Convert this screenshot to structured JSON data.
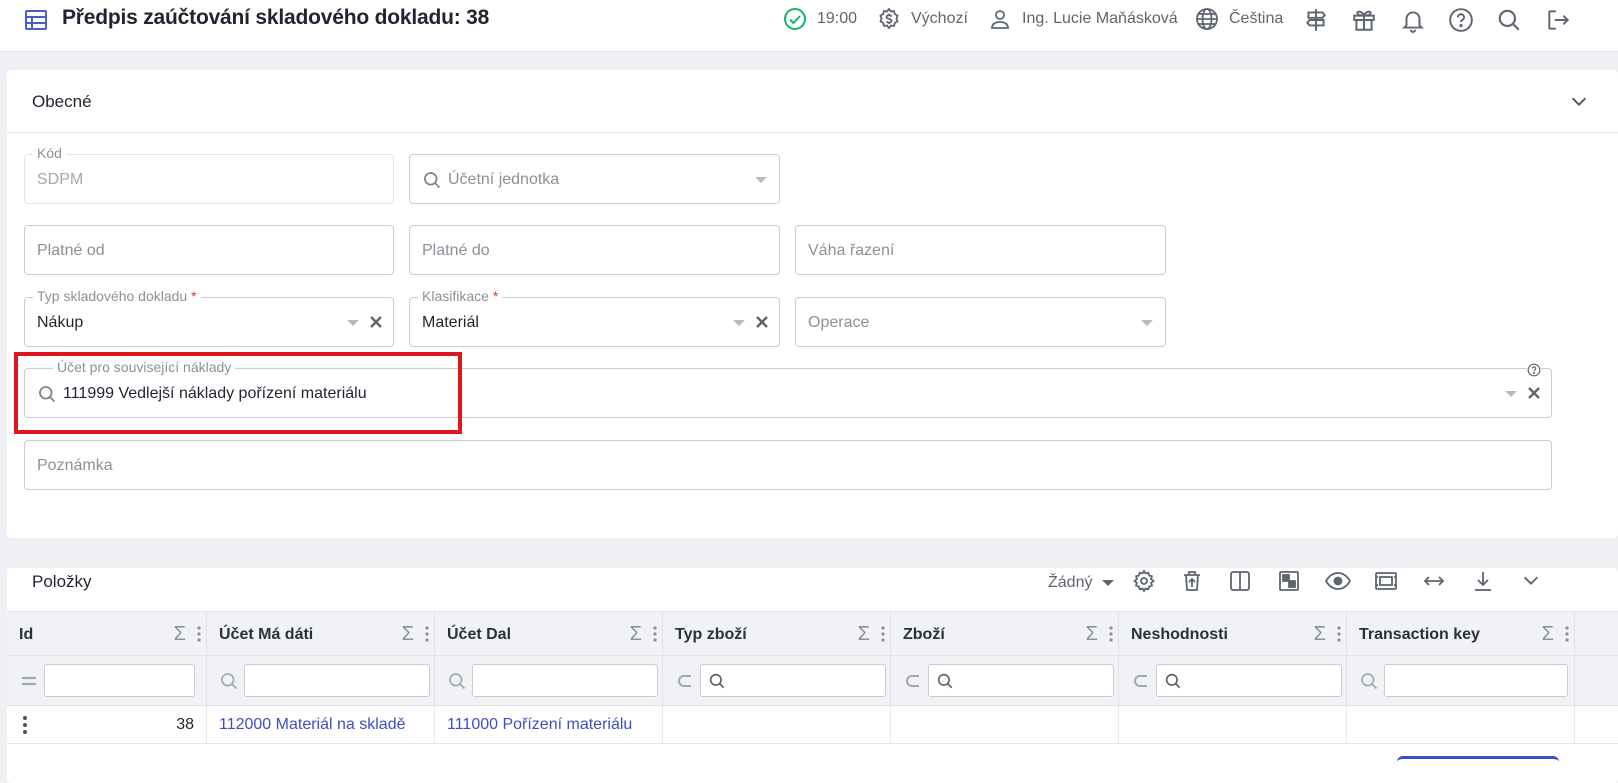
{
  "header": {
    "title": "Předpis zaúčtování skladového dokladu: 38",
    "time": "19:00",
    "currency_profile": "Výchozí",
    "user": "Ing. Lucie Maňásková",
    "language": "Čeština"
  },
  "general": {
    "title": "Obecné",
    "kod": {
      "label": "Kód",
      "value": "SDPM"
    },
    "ucetni_jednotka": {
      "placeholder": "Účetní jednotka"
    },
    "platne_od": {
      "placeholder": "Platné od"
    },
    "platne_do": {
      "placeholder": "Platné do"
    },
    "vaha_razeni": {
      "placeholder": "Váha řazení"
    },
    "typ_dokladu": {
      "label": "Typ skladového dokladu",
      "required": "*",
      "value": "Nákup"
    },
    "klasifikace": {
      "label": "Klasifikace",
      "required": "*",
      "value": "Materiál"
    },
    "operace": {
      "placeholder": "Operace"
    },
    "ucet_naklady": {
      "label": "Účet pro související náklady",
      "value": "111999 Vedlejší náklady pořízení materiálu"
    },
    "poznamka": {
      "placeholder": "Poznámka"
    }
  },
  "items": {
    "title": "Položky",
    "grouping": "Žádný",
    "columns": [
      {
        "label": "Id"
      },
      {
        "label": "Účet Má dáti"
      },
      {
        "label": "Účet Dal"
      },
      {
        "label": "Typ zboží"
      },
      {
        "label": "Zboží"
      },
      {
        "label": "Neshodnosti"
      },
      {
        "label": "Transaction key"
      }
    ],
    "sigma": "Σ",
    "rows": [
      {
        "id": "38",
        "ucet_ma_dati": "112000 Materiál na skladě",
        "ucet_dal": "111000 Pořízení materiálu",
        "typ_zbozi": "",
        "zbozi": "",
        "neshodnosti": "",
        "transaction_key": ""
      }
    ]
  },
  "colors": {
    "accent": "#4a5bd1",
    "link": "#3d4fc4",
    "ok": "#18b26b",
    "required": "#e03535",
    "highlight": "#e0161e"
  }
}
